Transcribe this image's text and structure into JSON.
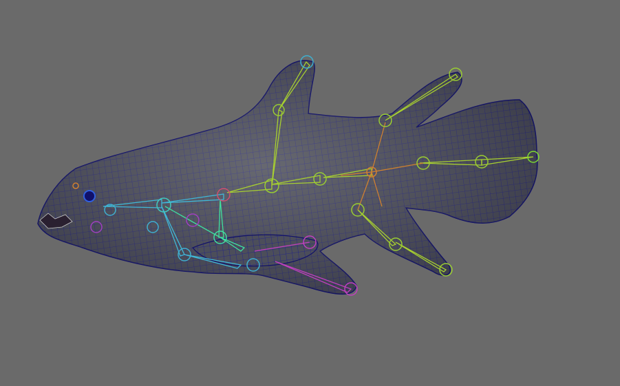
{
  "viewport": {
    "background_color": "#6a6a6a",
    "mesh_fill_color": "#4a4c58",
    "wireframe_color": "#1a1a8c",
    "joint_colors": {
      "spine": "#9acd32",
      "head": "#3fb0d0",
      "pectoral": "#40e0b0",
      "pelvic": "#c040c0",
      "root": "#d08030",
      "tail": "#7fdc30"
    }
  }
}
